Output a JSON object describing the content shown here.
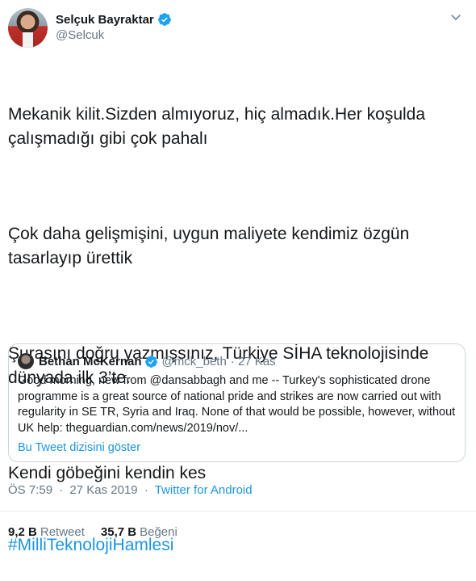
{
  "author": {
    "name": "Selçuk Bayraktar",
    "handle": "@Selcuk"
  },
  "tweet": {
    "paragraphs": [
      "Mekanik kilit.Sizden almıyoruz, hiç almadık.Her koşulda çalışmadığı gibi çok pahalı",
      "Çok daha gelişmişini, uygun maliyete kendimiz özgün tasarlayıp ürettik",
      "Şurasını doğru yazmışsınız, Türkiye SİHA teknolojisinde dünyada ilk 3’te.",
      "Kendi göbeğini kendin kes"
    ],
    "hashtag": "#MilliTeknolojiHamlesi"
  },
  "quote": {
    "name": "Bethan McKernan",
    "handle": "@mck_beth",
    "date": "· 27 Kas",
    "text": "Good morning, new from @dansabbagh and me -- Turkey's sophisticated drone programme is a great source of national pride and strikes are now carried out with regularity in SE TR, Syria and Iraq. None of that would be possible, however, without UK help: theguardian.com/news/2019/nov/...",
    "thread_link": "Bu Tweet dizisini göster"
  },
  "meta": {
    "time": "ÖS 7:59",
    "date": "27 Kas 2019",
    "separator": "·",
    "source": "Twitter for Android"
  },
  "stats": {
    "retweets_count": "9,2 B",
    "retweets_label": "Retweet",
    "likes_count": "35,7 B",
    "likes_label": "Beğeni"
  },
  "icons": {
    "verified": "verified-badge-icon",
    "menu": "chevron-down-icon"
  },
  "colors": {
    "accent": "#1b95e0",
    "secondary_text": "#657786",
    "border": "#ccd6dd"
  }
}
